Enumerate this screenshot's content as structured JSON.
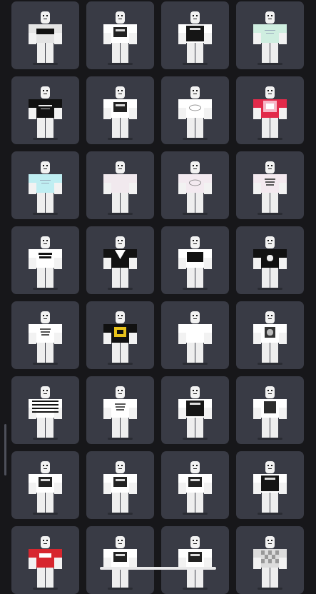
{
  "catalog": {
    "items": [
      {
        "shirt": "#e4e4e4",
        "torso": "#ffffff",
        "trim": "#111111",
        "print": "bar"
      },
      {
        "shirt": "#ffffff",
        "torso": "#ffffff",
        "trim": "#ffffff",
        "print": "dark-graphic"
      },
      {
        "shirt": "#ffffff",
        "torso": "#ffffff",
        "trim": "#333333",
        "print": "black-tee"
      },
      {
        "shirt": "#cfeee0",
        "torso": "#dff6ec",
        "trim": "#cfeee0",
        "print": "light-lines"
      },
      {
        "shirt": "#111111",
        "torso": "#1a1a1a",
        "trim": "#111111",
        "print": "white-text"
      },
      {
        "shirt": "#ffffff",
        "torso": "#ffffff",
        "trim": "#222222",
        "print": "dark-graphic"
      },
      {
        "shirt": "#ffffff",
        "torso": "#ffffff",
        "trim": "#ffffff",
        "print": "line-art"
      },
      {
        "shirt": "#e22a4a",
        "torso": "#ffffff",
        "trim": "#e22a4a",
        "print": "pink-cat"
      },
      {
        "shirt": "#bfeef2",
        "torso": "#e2f7fa",
        "trim": "#bfeef2",
        "print": "light-lines"
      },
      {
        "shirt": "#f1e9ee",
        "torso": "#f3eef1",
        "trim": "#f1e9ee",
        "print": "none"
      },
      {
        "shirt": "#f3eaf0",
        "torso": "#f3eef3",
        "trim": "#f3eaf0",
        "print": "line-art"
      },
      {
        "shirt": "#f3e9ef",
        "torso": "#f3eef3",
        "trim": "#f3e9ef",
        "print": "small-text"
      },
      {
        "shirt": "#ffffff",
        "torso": "#ffffff",
        "trim": "#ffffff",
        "print": "black-text"
      },
      {
        "shirt": "#121212",
        "torso": "#ffffff",
        "trim": "#121212",
        "print": "v-neck"
      },
      {
        "shirt": "#ffffff",
        "torso": "#ffffff",
        "trim": "#ffffff",
        "print": "black-box"
      },
      {
        "shirt": "#111111",
        "torso": "#1a1a1a",
        "trim": "#111111",
        "print": "white-icon"
      },
      {
        "shirt": "#ffffff",
        "torso": "#ffffff",
        "trim": "#ffffff",
        "print": "small-text"
      },
      {
        "shirt": "#111111",
        "torso": "#1a1a1a",
        "trim": "#111111",
        "print": "yellow-graphic"
      },
      {
        "shirt": "#ffffff",
        "torso": "#ffffff",
        "trim": "#111111",
        "print": "v-neck"
      },
      {
        "shirt": "#ffffff",
        "torso": "#ffffff",
        "trim": "#ffffff",
        "print": "face-graphic"
      },
      {
        "shirt": "#ffffff",
        "torso": "#ffffff",
        "trim": "#111111",
        "print": "stripes"
      },
      {
        "shirt": "#ffffff",
        "torso": "#ffffff",
        "trim": "#ffffff",
        "print": "small-text"
      },
      {
        "shirt": "#ffffff",
        "torso": "#ffffff",
        "trim": "#111111",
        "print": "black-tee"
      },
      {
        "shirt": "#ffffff",
        "torso": "#ffffff",
        "trim": "#222222",
        "print": "photo"
      },
      {
        "shirt": "#ffffff",
        "torso": "#ffffff",
        "trim": "#111111",
        "print": "dark-graphic"
      },
      {
        "shirt": "#ffffff",
        "torso": "#ffffff",
        "trim": "#ffffff",
        "print": "dark-graphic"
      },
      {
        "shirt": "#ffffff",
        "torso": "#ffffff",
        "trim": "#111111",
        "print": "dark-graphic"
      },
      {
        "shirt": "#ffffff",
        "torso": "#ffffff",
        "trim": "#ffffff",
        "print": "black-tee"
      },
      {
        "shirt": "#d7262e",
        "torso": "#ffffff",
        "trim": "#d7262e",
        "print": "red-tee"
      },
      {
        "shirt": "#ffffff",
        "torso": "#ffffff",
        "trim": "#111111",
        "print": "dark-graphic"
      },
      {
        "shirt": "#ffffff",
        "torso": "#ffffff",
        "trim": "#111111",
        "print": "dark-graphic"
      },
      {
        "shirt": "#dcdcdc",
        "torso": "#eeeeee",
        "trim": "#888888",
        "print": "check"
      }
    ],
    "colors": {
      "background": "#17171a",
      "card": "#393b45",
      "skin": "#f2f2f2",
      "pants": "#eeeeee"
    }
  }
}
